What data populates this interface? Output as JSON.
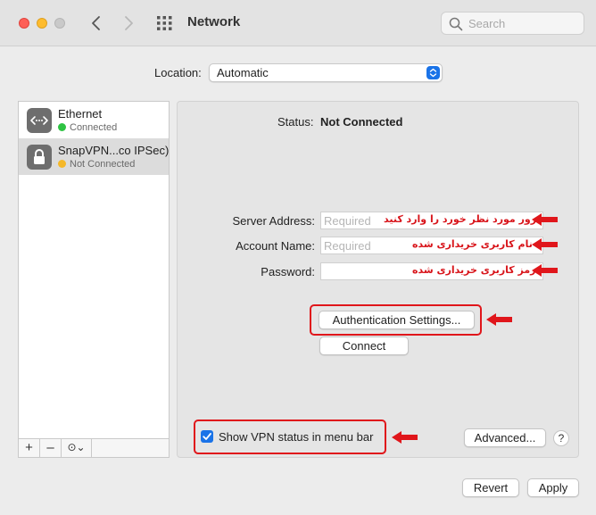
{
  "window": {
    "title": "Network",
    "search_placeholder": "Search"
  },
  "location": {
    "label": "Location:",
    "value": "Automatic"
  },
  "services": [
    {
      "name": "Ethernet",
      "status": "Connected",
      "status_color": "#2ec343"
    },
    {
      "name": "SnapVPN...co IPSec)",
      "status": "Not Connected",
      "status_color": "#f5b829"
    }
  ],
  "sidebar_tools": {
    "add": "+",
    "remove": "–",
    "action": "⊙⌄"
  },
  "detail": {
    "status_label": "Status:",
    "status_value": "Not Connected",
    "server_label": "Server Address:",
    "server_placeholder": "Required",
    "server_note": "سرور مورد نظر خورد را وارد کنید",
    "account_label": "Account Name:",
    "account_placeholder": "Required",
    "account_note": "نام کاربری خریداری شده",
    "password_label": "Password:",
    "password_note": "رمز کاربری خریداری شده",
    "auth_button": "Authentication Settings...",
    "connect_button": "Connect",
    "show_status_label": "Show VPN status in menu bar",
    "show_status_checked": true,
    "advanced_button": "Advanced...",
    "help_button": "?"
  },
  "footer": {
    "revert": "Revert",
    "apply": "Apply"
  },
  "colors": {
    "accent": "#1a73e8",
    "annotation": "#d8151b"
  }
}
